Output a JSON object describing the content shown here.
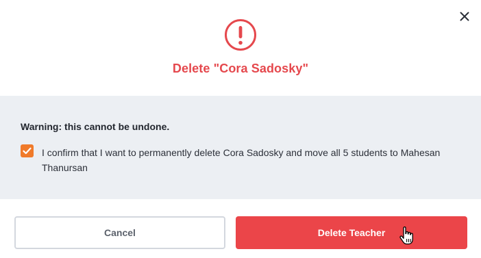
{
  "dialog": {
    "title": "Delete \"Cora Sadosky\"",
    "warning_heading": "Warning: this cannot be undone.",
    "confirm_label": "I confirm that I want to permanently delete Cora Sadosky and move all 5 students to Mahesan Thanursan",
    "confirm_checked": true
  },
  "buttons": {
    "cancel_label": "Cancel",
    "delete_label": "Delete Teacher"
  },
  "icons": {
    "close": "close-icon",
    "alert": "exclamation-circle-icon",
    "checkbox": "checkmark-icon",
    "cursor": "hand-pointer-icon"
  },
  "colors": {
    "accent_red": "#eb4549",
    "title_red": "#e5484d",
    "checkbox_orange": "#f07a2a",
    "panel_gray": "#eceff3"
  }
}
